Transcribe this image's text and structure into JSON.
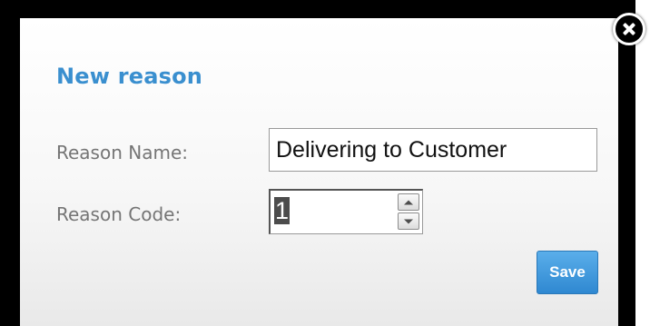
{
  "dialog": {
    "title": "New reason",
    "close_icon": "close-icon"
  },
  "form": {
    "reason_name_label": "Reason Name:",
    "reason_name_value": "Delivering to Customer",
    "reason_code_label": "Reason Code:",
    "reason_code_value": "1"
  },
  "actions": {
    "save_label": "Save"
  },
  "colors": {
    "title": "#3a8fcf",
    "label": "#757575",
    "save_button": "#2f88d1"
  }
}
